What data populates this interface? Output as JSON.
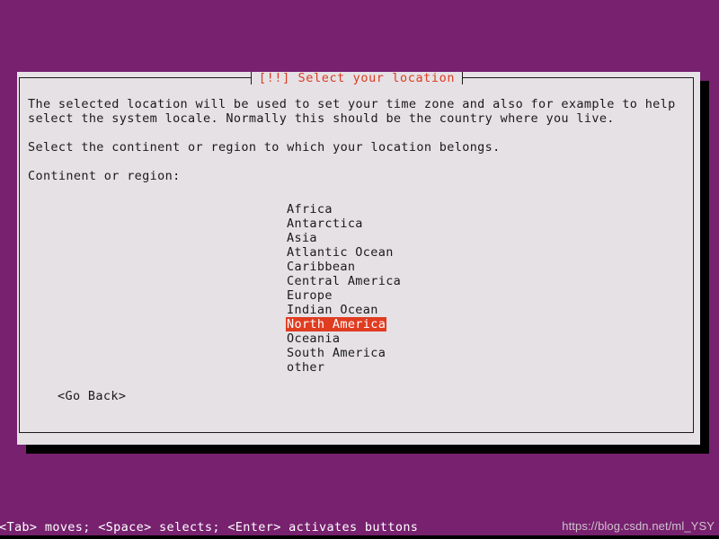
{
  "theme": {
    "desktop_background": "#77216F",
    "dialog_background": "#E6E1E5",
    "dialog_border": "#1a1a1a",
    "title_color": "#DB3B21",
    "selection_background": "#E03C20",
    "selection_text": "#FFFFFF",
    "text_color": "#1a1a1a",
    "help_text_color": "#FFFFFF",
    "watermark_color": "#CFC2CE",
    "shadow_color": "#000000"
  },
  "dialog": {
    "title": "[!!] Select your location",
    "paragraphs": [
      "The selected location will be used to set your time zone and also for example to help\nselect the system locale. Normally this should be the country where you live.",
      "Select the continent or region to which your location belongs."
    ],
    "field_label": "Continent or region:",
    "regions": [
      {
        "label": "Africa",
        "selected": false
      },
      {
        "label": "Antarctica",
        "selected": false
      },
      {
        "label": "Asia",
        "selected": false
      },
      {
        "label": "Atlantic Ocean",
        "selected": false
      },
      {
        "label": "Caribbean",
        "selected": false
      },
      {
        "label": "Central America",
        "selected": false
      },
      {
        "label": "Europe",
        "selected": false
      },
      {
        "label": "Indian Ocean",
        "selected": false
      },
      {
        "label": "North America",
        "selected": true
      },
      {
        "label": "Oceania",
        "selected": false
      },
      {
        "label": "South America",
        "selected": false
      },
      {
        "label": "other",
        "selected": false
      }
    ],
    "selected_region": "North America",
    "go_back_label": "<Go Back>"
  },
  "status_bar": {
    "help_text": "<Tab> moves; <Space> selects; <Enter> activates buttons",
    "watermark": "https://blog.csdn.net/ml_YSY"
  }
}
